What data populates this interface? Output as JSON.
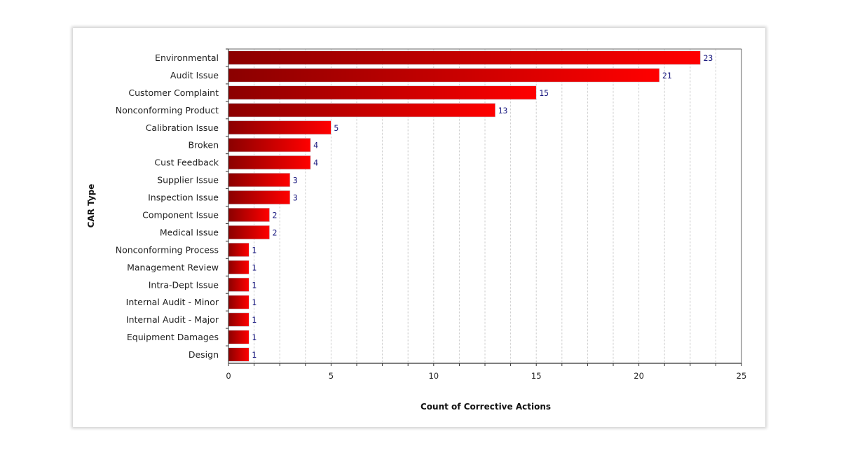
{
  "chart_data": {
    "type": "bar",
    "orientation": "horizontal",
    "title": "",
    "xlabel": "Count of Corrective Actions",
    "ylabel": "CAR Type",
    "xlim": [
      0,
      25
    ],
    "x_ticks": [
      0,
      5,
      10,
      15,
      20,
      25
    ],
    "x_tick_labels": [
      "0",
      "5",
      "10",
      "15",
      "20",
      "25"
    ],
    "minor_grid_step": 1.25,
    "grid": true,
    "legend": "none",
    "categories": [
      "Environmental",
      "Audit Issue",
      "Customer Complaint",
      "Nonconforming Product",
      "Calibration Issue",
      "Broken",
      "Cust Feedback",
      "Supplier Issue",
      "Inspection Issue",
      "Component Issue",
      "Medical Issue",
      "Nonconforming Process",
      "Management Review",
      "Intra-Dept Issue",
      "Internal Audit - Minor",
      "Internal Audit - Major",
      "Equipment Damages",
      "Design"
    ],
    "values": [
      23,
      21,
      15,
      13,
      5,
      4,
      4,
      3,
      3,
      2,
      2,
      1,
      1,
      1,
      1,
      1,
      1,
      1
    ],
    "data_labels": true,
    "colors": {
      "bar_dark": "#8b0000",
      "bar_light": "#ff0000",
      "value_label": "#1a1a80",
      "grid": "#c8c8c8",
      "axis": "#333333"
    }
  }
}
